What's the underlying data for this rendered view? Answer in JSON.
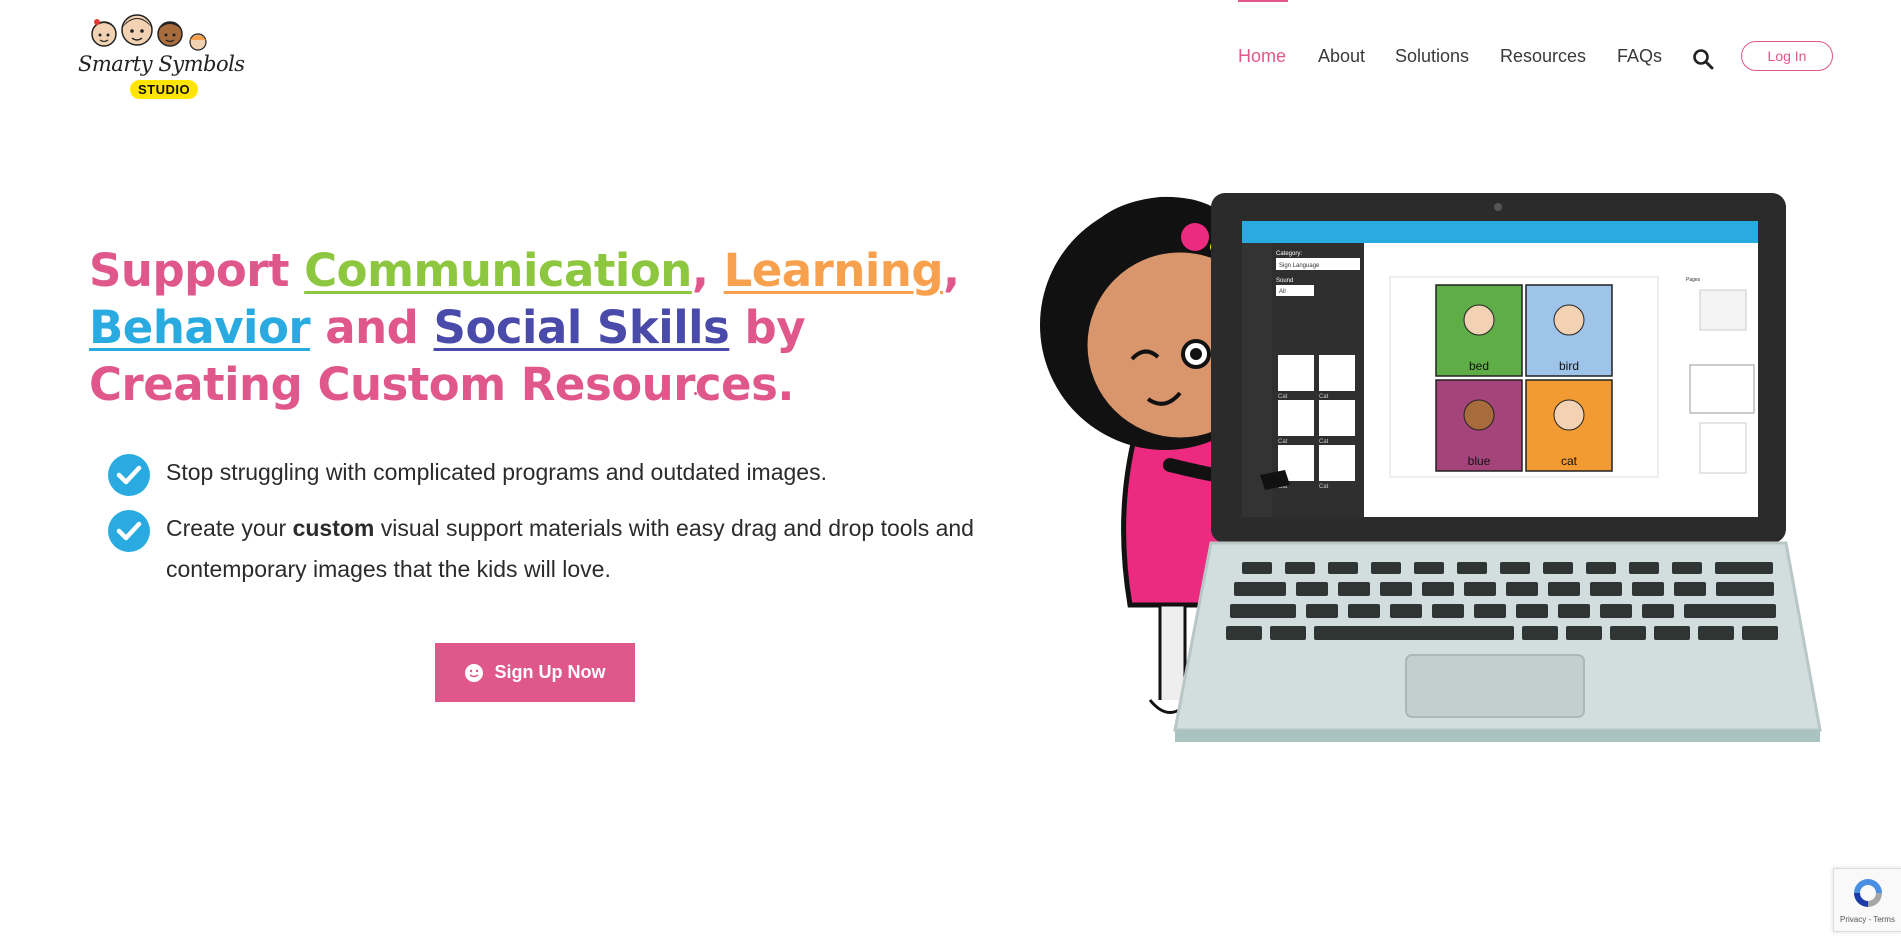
{
  "brand": {
    "logo_script": "Smarty Symbols",
    "logo_badge": "STUDIO"
  },
  "nav": {
    "items": [
      {
        "label": "Home",
        "active": true
      },
      {
        "label": "About",
        "active": false
      },
      {
        "label": "Solutions",
        "active": false
      },
      {
        "label": "Resources",
        "active": false
      },
      {
        "label": "FAQs",
        "active": false
      }
    ],
    "search_icon": "search-icon",
    "login_label": "Log In"
  },
  "hero": {
    "headline": {
      "w1": "Support ",
      "link1": "Communication",
      "sep1": ", ",
      "link2": "Learning",
      "sep2": ",",
      "link3": "Behavior",
      "w2": " and ",
      "link4": "Social Skills",
      "w3": " by Creating Custom Resources."
    },
    "bullets": [
      {
        "pre": "Stop struggling with complicated programs and outdated images.",
        "bold": "",
        "post": ""
      },
      {
        "pre": "Create your ",
        "bold": "custom",
        "post": " visual support materials with easy drag and drop tools and contemporary images that the kids will love."
      }
    ],
    "cta_label": "Sign Up Now"
  },
  "illustration": {
    "app_category_label": "Category:",
    "app_category_value": "Sign Language",
    "app_sound_label": "Sound",
    "app_sound_value": "All",
    "card_words": [
      "bed",
      "bird",
      "blue",
      "cat"
    ],
    "thumb_labels": [
      "Cat",
      "Cat",
      "Cat",
      "Cat",
      "Cat",
      "Cat"
    ],
    "pages_label": "Pages"
  },
  "recaptcha": {
    "text": "Privacy - Terms"
  },
  "colors": {
    "brand_pink": "#e0578b",
    "green": "#8dc63f",
    "orange": "#f7a14f",
    "blue": "#29abe2",
    "indigo": "#4a4aaa"
  }
}
